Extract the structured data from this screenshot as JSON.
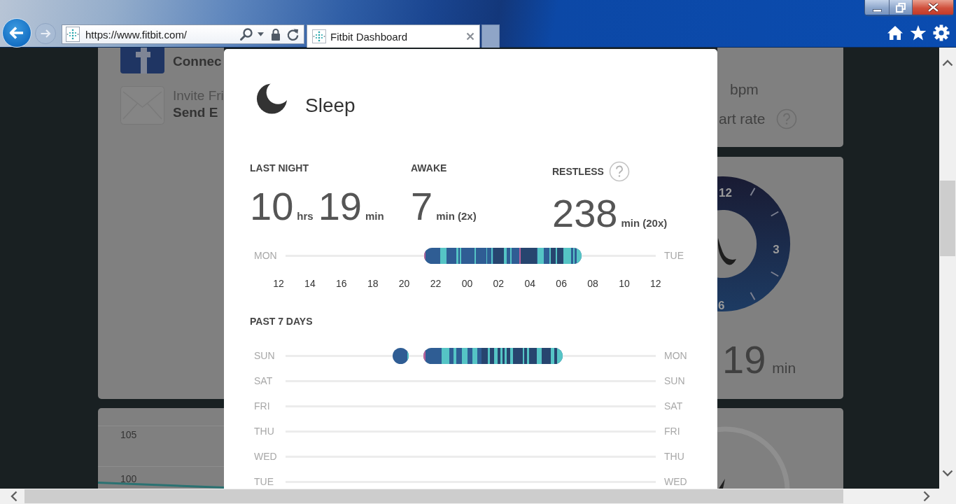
{
  "browser": {
    "address_bar": {
      "value": "https://www.fitbit.com/"
    },
    "tabs": [
      {
        "title": "Fitbit Dashboard",
        "selected": true
      }
    ]
  },
  "dashboard": {
    "connect_card": {
      "items": [
        {
          "kind": "connect",
          "lines": [
            {
              "text": "Connec",
              "bold": true
            }
          ]
        },
        {
          "kind": "invite",
          "lines": [
            {
              "text": "Invite Fri",
              "bold": false
            },
            {
              "text": "Send E",
              "bold": true
            }
          ]
        }
      ]
    },
    "heart_rate_card": {
      "unit": "bpm",
      "label": "art rate",
      "help": true
    },
    "sleep_card": {
      "dial_labels": [
        "12",
        "3",
        "6"
      ],
      "value": "19",
      "unit": "min"
    },
    "chart_card": {
      "y_labels": [
        "105",
        "100"
      ]
    }
  },
  "sleep_panel": {
    "title": "Sleep",
    "stats": [
      {
        "label": "LAST NIGHT",
        "help": false,
        "parts": [
          {
            "value": "10",
            "unit": "hrs"
          },
          {
            "value": "19",
            "unit": "min"
          }
        ]
      },
      {
        "label": "AWAKE",
        "help": false,
        "parts": [
          {
            "value": "7",
            "unit": "min (2x)"
          }
        ]
      },
      {
        "label": "RESTLESS",
        "help": true,
        "parts": [
          {
            "value": "238",
            "unit": "min (20x)"
          }
        ]
      }
    ],
    "last_night": {
      "start_day": "MON",
      "end_day": "TUE",
      "sleep_recorded": true,
      "hour_labels": [
        "12",
        "14",
        "16",
        "18",
        "20",
        "22",
        "00",
        "02",
        "04",
        "06",
        "08",
        "10",
        "12"
      ]
    },
    "past_7_days": {
      "title": "PAST 7 DAYS",
      "rows": [
        {
          "start_day": "SUN",
          "end_day": "MON",
          "sleep_recorded": true
        },
        {
          "start_day": "SAT",
          "end_day": "SUN",
          "sleep_recorded": false
        },
        {
          "start_day": "FRI",
          "end_day": "SAT",
          "sleep_recorded": false
        },
        {
          "start_day": "THU",
          "end_day": "FRI",
          "sleep_recorded": false
        },
        {
          "start_day": "WED",
          "end_day": "THU",
          "sleep_recorded": false
        },
        {
          "start_day": "TUE",
          "end_day": "WED",
          "sleep_recorded": false
        }
      ]
    }
  }
}
